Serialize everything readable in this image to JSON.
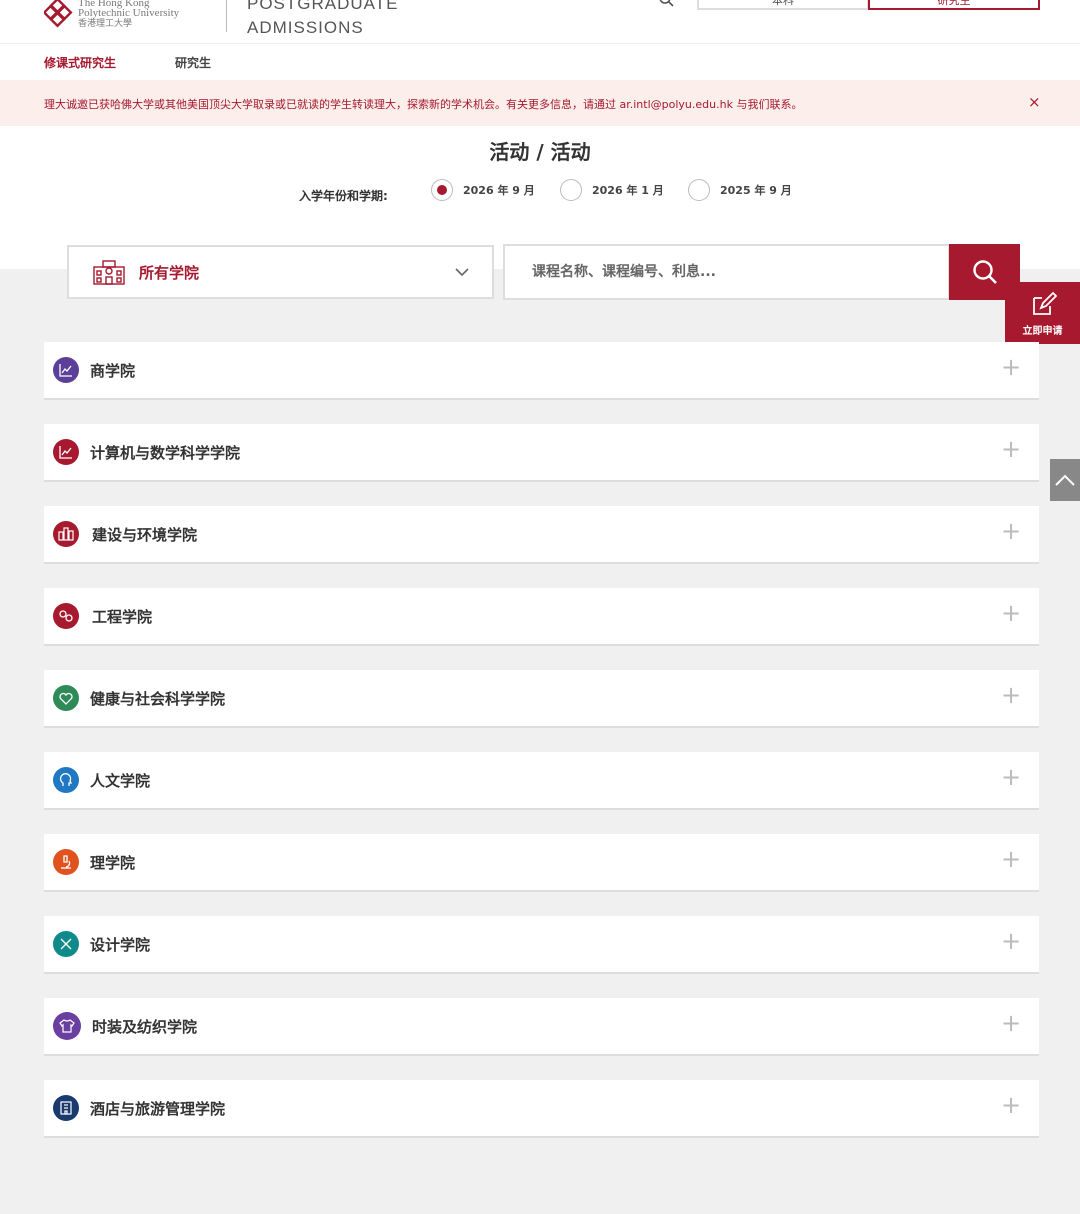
{
  "header": {
    "logo_line1": "The Hong Kong",
    "logo_line2": "Polytechnic University",
    "logo_cn": "香港理工大學",
    "title_line1": "POSTGRADUATE",
    "title_line2": "ADMISSIONS",
    "btn_undergrad": "本科",
    "btn_postgrad": "研究生"
  },
  "subnav": {
    "active": "修课式研究生",
    "other": "研究生"
  },
  "notice": {
    "text": "理大诚邀已获哈佛大学或其他美国顶尖大学取录或已就读的学生转读理大，探索新的学术机会。有关更多信息，请通过 ar.intl@polyu.edu.hk 与我们联系。",
    "close": "×"
  },
  "page": {
    "title": "活动 / 活动",
    "intake_label": "入学年份和学期:",
    "intakes": [
      {
        "label": "2026 年 9 月",
        "checked": true
      },
      {
        "label": "2026 年 1 月",
        "checked": false
      },
      {
        "label": "2025 年 9 月",
        "checked": false
      }
    ]
  },
  "filter": {
    "faculty_selected": "所有学院",
    "search_placeholder": "课程名称、课程编号、利息...",
    "apply_label": "立即申请"
  },
  "faculties": [
    {
      "label": "商学院",
      "color": "#5b3f98",
      "icon": "chart-icon"
    },
    {
      "label": "计算机与数学科学学院",
      "color": "#a6192e",
      "icon": "chart-icon"
    },
    {
      "label": "建设与环境学院",
      "color": "#a6192e",
      "icon": "buildings-icon"
    },
    {
      "label": "工程学院",
      "color": "#a6192e",
      "icon": "gears-icon"
    },
    {
      "label": "健康与社会科学学院",
      "color": "#2e8b57",
      "icon": "heart-icon"
    },
    {
      "label": "人文学院",
      "color": "#1f78c1",
      "icon": "head-icon"
    },
    {
      "label": "理学院",
      "color": "#e0531f",
      "icon": "microscope-icon"
    },
    {
      "label": "设计学院",
      "color": "#0f8a8a",
      "icon": "pencil-ruler-icon"
    },
    {
      "label": "时装及纺织学院",
      "color": "#6a3fa0",
      "icon": "shirt-icon"
    },
    {
      "label": "酒店与旅游管理学院",
      "color": "#1a3a6e",
      "icon": "hotel-icon"
    }
  ],
  "colors": {
    "brand": "#a6192e",
    "notice_bg": "#fbeeeb"
  }
}
